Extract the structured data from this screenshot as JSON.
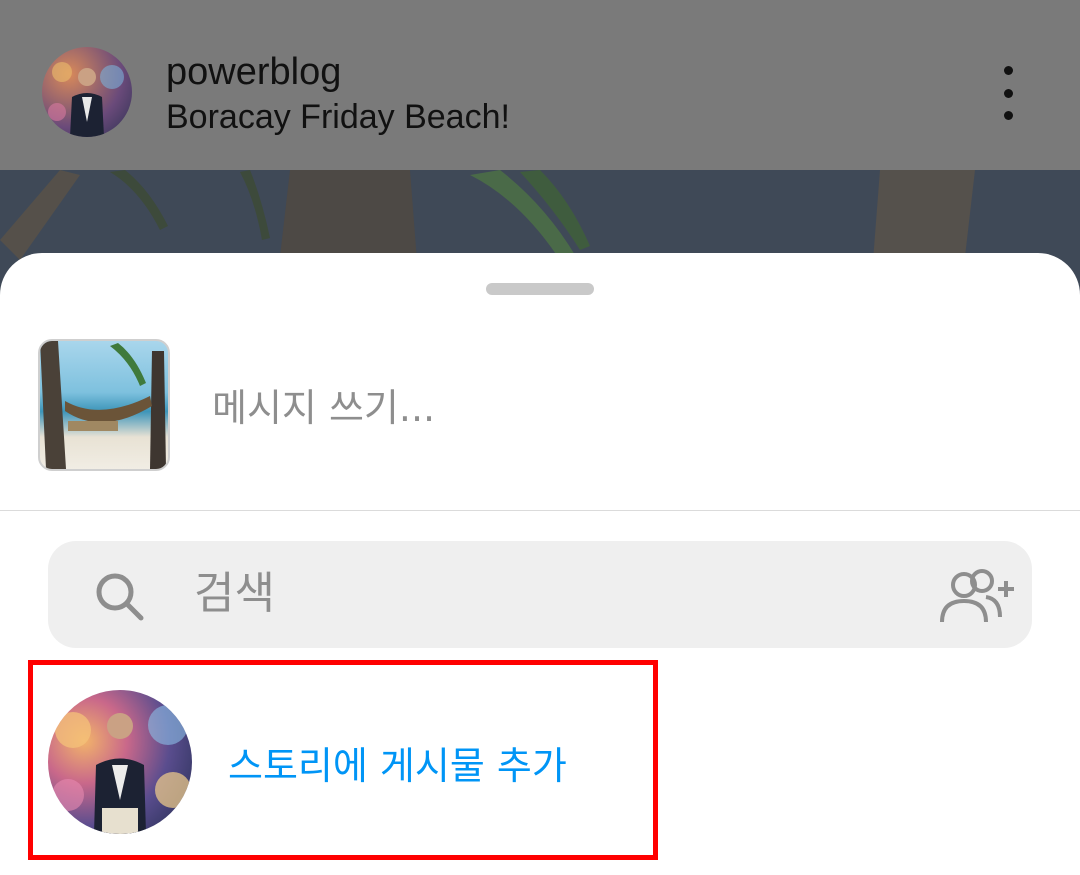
{
  "post": {
    "username": "powerblog",
    "caption": "Boracay Friday Beach!",
    "more_icon": "more-vertical-icon"
  },
  "share_sheet": {
    "message_placeholder": "메시지 쓰기...",
    "search_placeholder": "검색",
    "search_icon": "search-icon",
    "add_people_icon": "add-people-icon",
    "story_action_label": "스토리에 게시물 추가"
  },
  "colors": {
    "link_blue": "#0095f6",
    "highlight_red": "#ff0000",
    "placeholder_gray": "#8e8e8e",
    "search_bg": "#efefef"
  }
}
